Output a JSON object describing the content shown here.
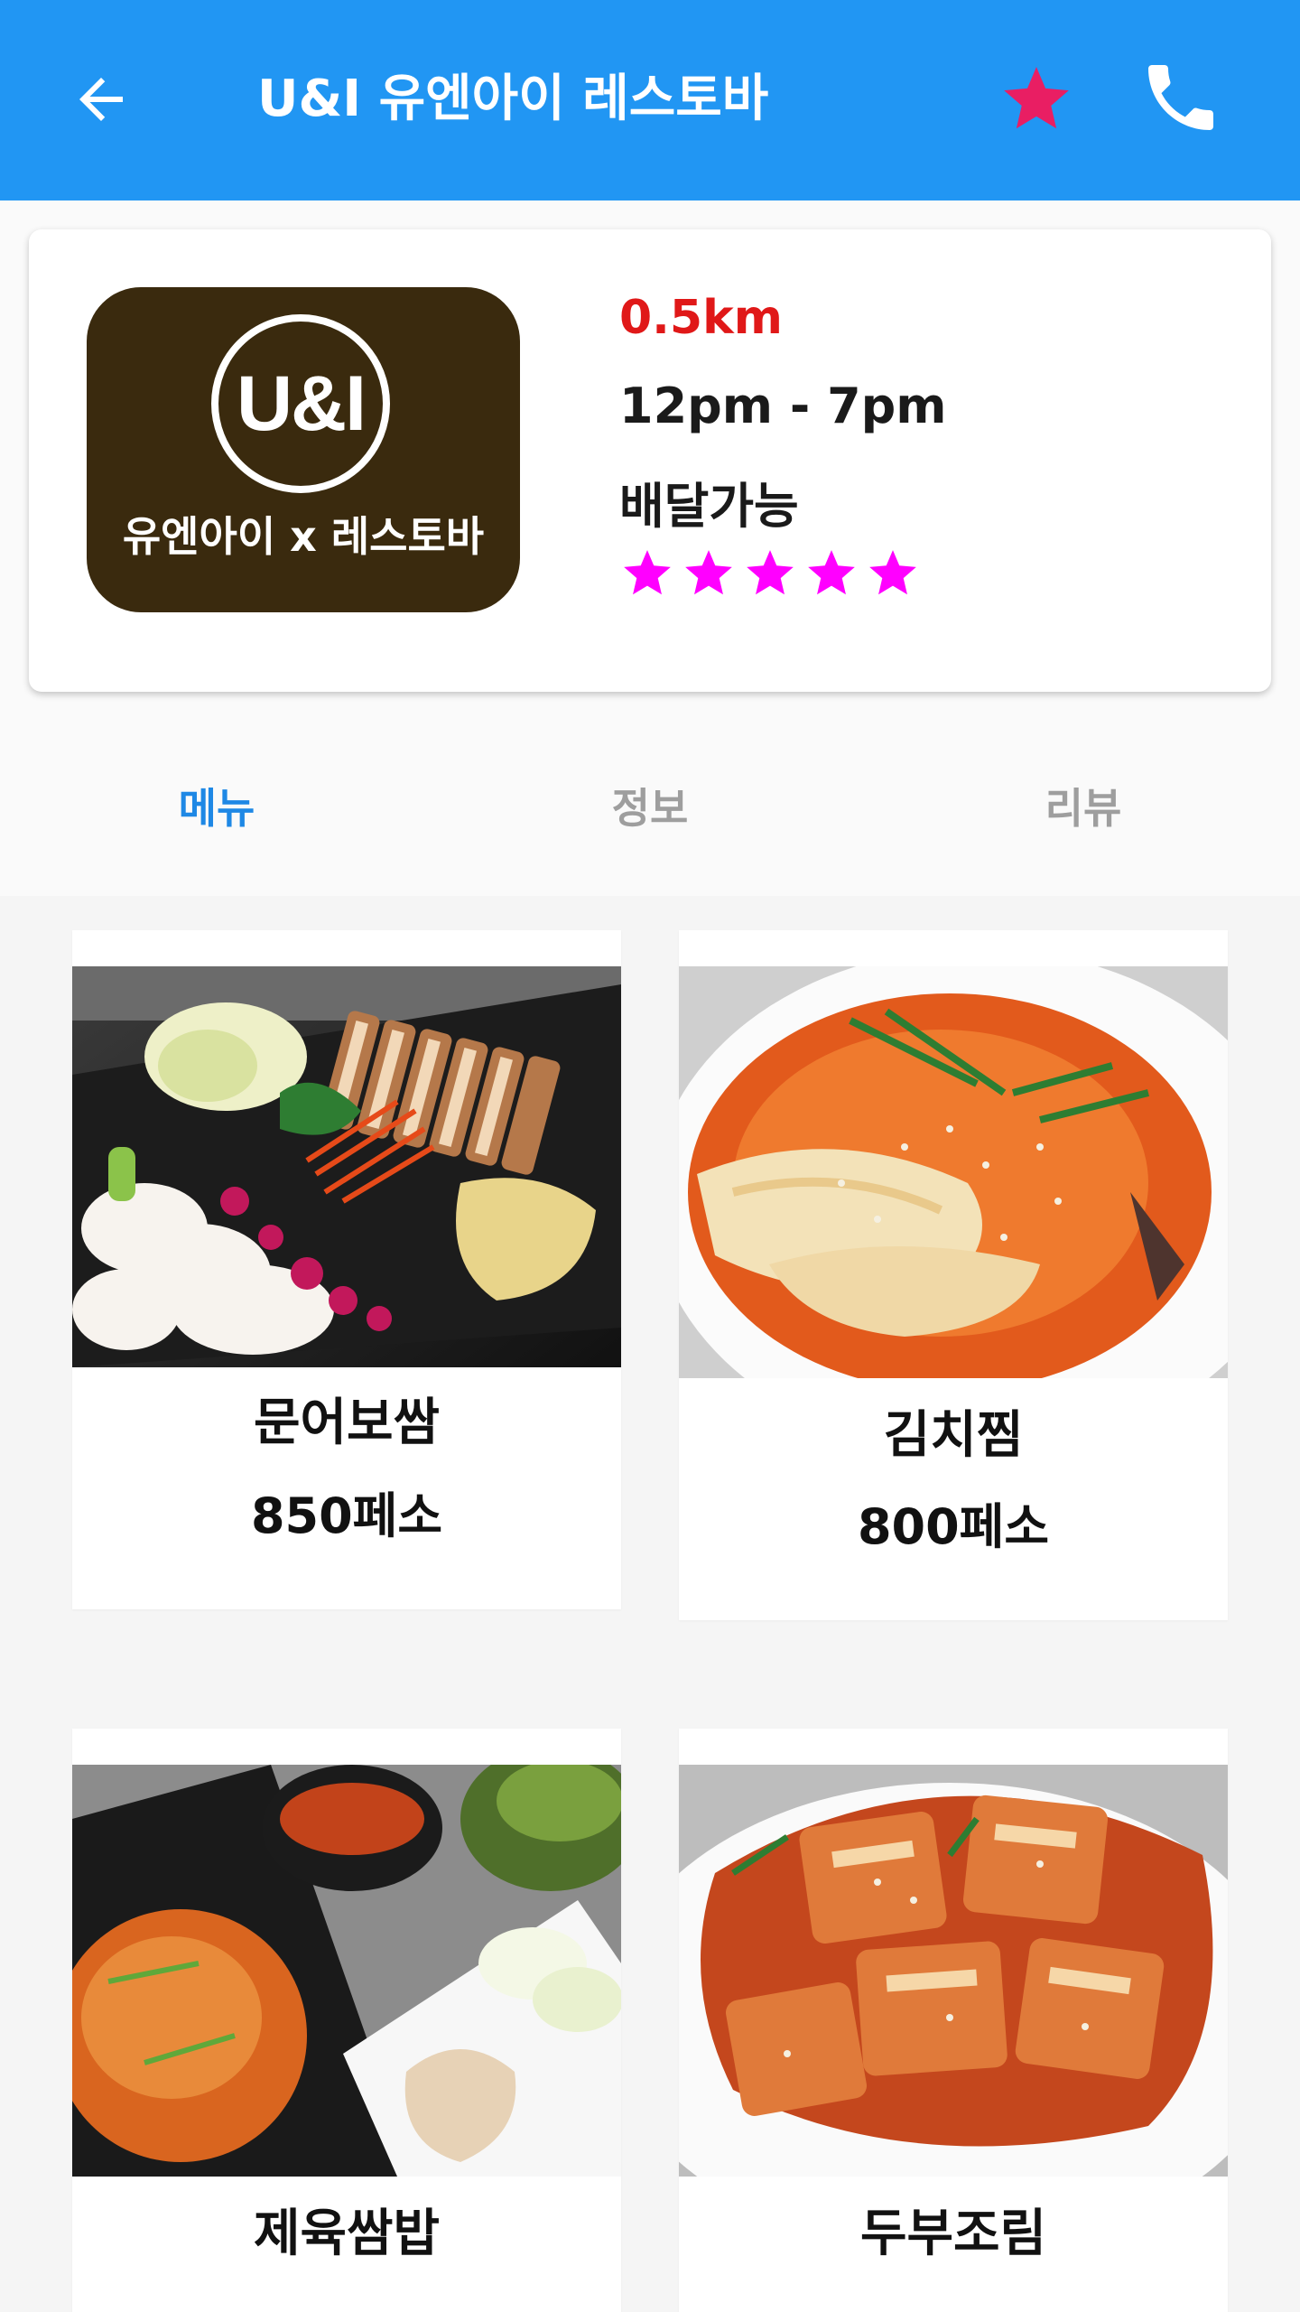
{
  "header": {
    "title": "U&I 유엔아이 레스토바",
    "back_icon": "arrow-left-icon",
    "favorite_icon": "star-icon",
    "call_icon": "phone-icon",
    "colors": {
      "bar": "#2196f3",
      "favorite": "#e91e63"
    }
  },
  "restaurant": {
    "logo": {
      "mark": "U&I",
      "subtitle": "유엔아이 x 레스토바"
    },
    "distance": "0.5km",
    "hours": "12pm - 7pm",
    "delivery": "배달가능",
    "rating": 5,
    "rating_max": 5,
    "colors": {
      "distance": "#e01818",
      "stars": "#ff00ff"
    }
  },
  "tabs": [
    {
      "label": "메뉴",
      "active": true
    },
    {
      "label": "정보",
      "active": false
    },
    {
      "label": "리뷰",
      "active": false
    }
  ],
  "menu": {
    "items": [
      {
        "name": "문어보쌈",
        "price": "850페소"
      },
      {
        "name": "김치찜",
        "price": "800페소"
      },
      {
        "name": "제육쌈밥",
        "price": ""
      },
      {
        "name": "두부조림",
        "price": ""
      }
    ]
  }
}
